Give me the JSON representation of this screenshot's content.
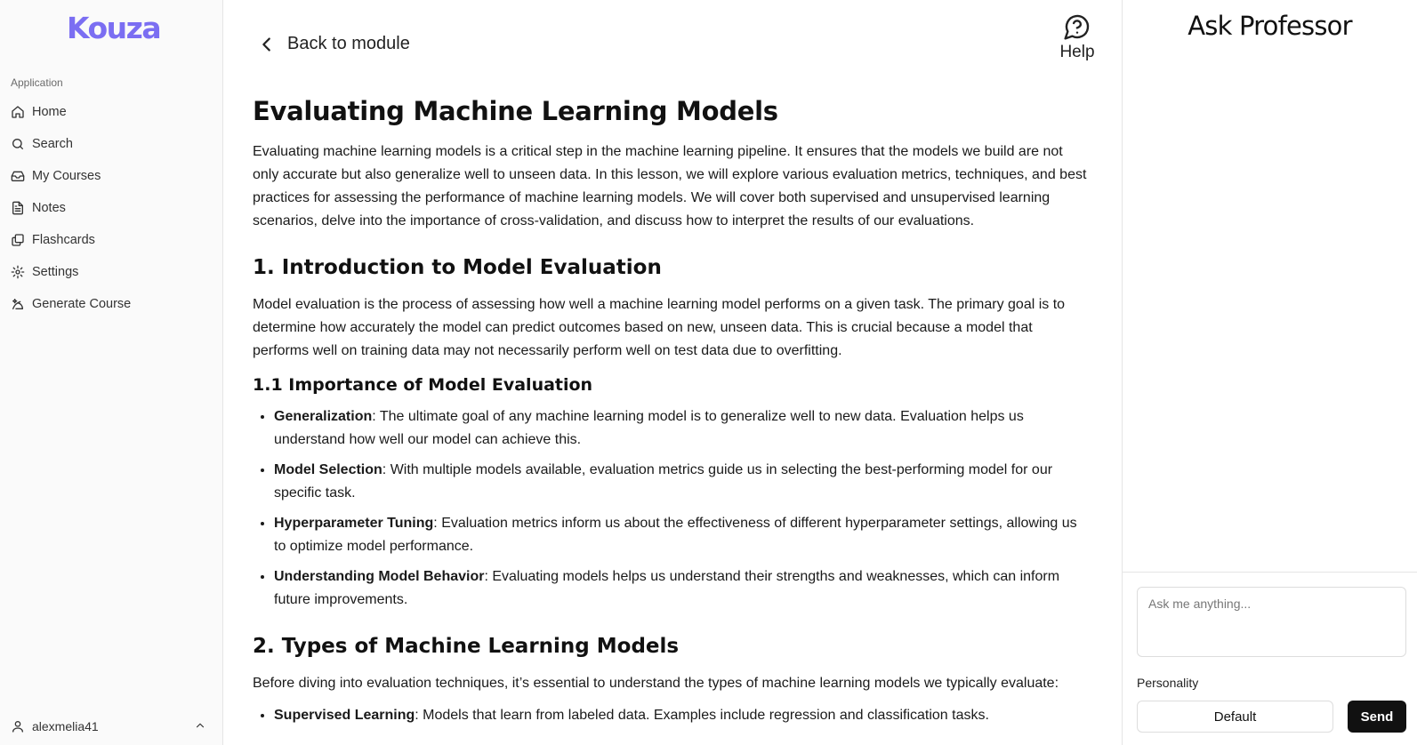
{
  "sidebar": {
    "logo": "Kouza",
    "section_label": "Application",
    "items": [
      {
        "label": "Home",
        "icon": "home-icon"
      },
      {
        "label": "Search",
        "icon": "search-icon"
      },
      {
        "label": "My Courses",
        "icon": "inbox-icon"
      },
      {
        "label": "Notes",
        "icon": "file-text-icon"
      },
      {
        "label": "Flashcards",
        "icon": "cards-icon"
      },
      {
        "label": "Settings",
        "icon": "gear-icon"
      },
      {
        "label": "Generate Course",
        "icon": "sparkle-icon"
      }
    ],
    "user": "alexmelia41"
  },
  "header": {
    "back_label": "Back to module",
    "help_label": "Help"
  },
  "article": {
    "title": "Evaluating Machine Learning Models",
    "intro": "Evaluating machine learning models is a critical step in the machine learning pipeline. It ensures that the models we build are not only accurate but also generalize well to unseen data. In this lesson, we will explore various evaluation metrics, techniques, and best practices for assessing the performance of machine learning models. We will cover both supervised and unsupervised learning scenarios, delve into the importance of cross-validation, and discuss how to interpret the results of our evaluations.",
    "s1_heading": "1. Introduction to Model Evaluation",
    "s1_para": "Model evaluation is the process of assessing how well a machine learning model performs on a given task. The primary goal is to determine how accurately the model can predict outcomes based on new, unseen data. This is crucial because a model that performs well on training data may not necessarily perform well on test data due to overfitting.",
    "s11_heading": "1.1 Importance of Model Evaluation",
    "s11_items": [
      {
        "term": "Generalization",
        "text": ": The ultimate goal of any machine learning model is to generalize well to new data. Evaluation helps us understand how well our model can achieve this."
      },
      {
        "term": "Model Selection",
        "text": ": With multiple models available, evaluation metrics guide us in selecting the best-performing model for our specific task."
      },
      {
        "term": "Hyperparameter Tuning",
        "text": ": Evaluation metrics inform us about the effectiveness of different hyperparameter settings, allowing us to optimize model performance."
      },
      {
        "term": "Understanding Model Behavior",
        "text": ": Evaluating models helps us understand their strengths and weaknesses, which can inform future improvements."
      }
    ],
    "s2_heading": "2. Types of Machine Learning Models",
    "s2_para": "Before diving into evaluation techniques, it’s essential to understand the types of machine learning models we typically evaluate:",
    "s2_items": [
      {
        "term": "Supervised Learning",
        "text": ": Models that learn from labeled data. Examples include regression and classification tasks."
      }
    ]
  },
  "panel": {
    "title": "Ask Professor",
    "input_placeholder": "Ask me anything...",
    "personality_label": "Personality",
    "personality_value": "Default",
    "send_label": "Send"
  },
  "colors": {
    "brand": "#7b6ef2",
    "send_button": "#111111"
  }
}
